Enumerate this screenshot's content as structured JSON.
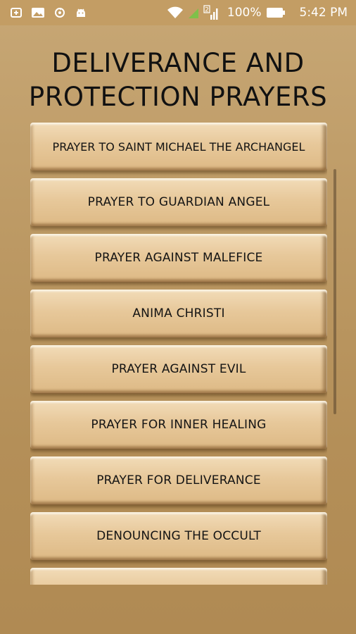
{
  "status_bar": {
    "left_icons": [
      "usb-debug-icon",
      "image-icon",
      "sync-icon",
      "android-icon"
    ],
    "battery_percent": "100%",
    "time": "5:42 PM",
    "sim_label": "2",
    "wifi": "wifi-full",
    "signal": "signal-full"
  },
  "header": {
    "title_line1": "DELIVERANCE AND",
    "title_line2": "PROTECTION PRAYERS"
  },
  "prayers": [
    {
      "label": "PRAYER TO SAINT MICHAEL THE ARCHANGEL"
    },
    {
      "label": "PRAYER TO GUARDIAN ANGEL"
    },
    {
      "label": "PRAYER AGAINST MALEFICE"
    },
    {
      "label": "ANIMA CHRISTI"
    },
    {
      "label": "PRAYER AGAINST EVIL"
    },
    {
      "label": "PRAYER FOR INNER HEALING"
    },
    {
      "label": "PRAYER FOR DELIVERANCE"
    },
    {
      "label": "DENOUNCING THE OCCULT"
    },
    {
      "label": ""
    }
  ],
  "colors": {
    "background": "#bd9a65",
    "status_bar": "#c39d64",
    "button_face": "#e7c89a",
    "text": "#141414"
  }
}
